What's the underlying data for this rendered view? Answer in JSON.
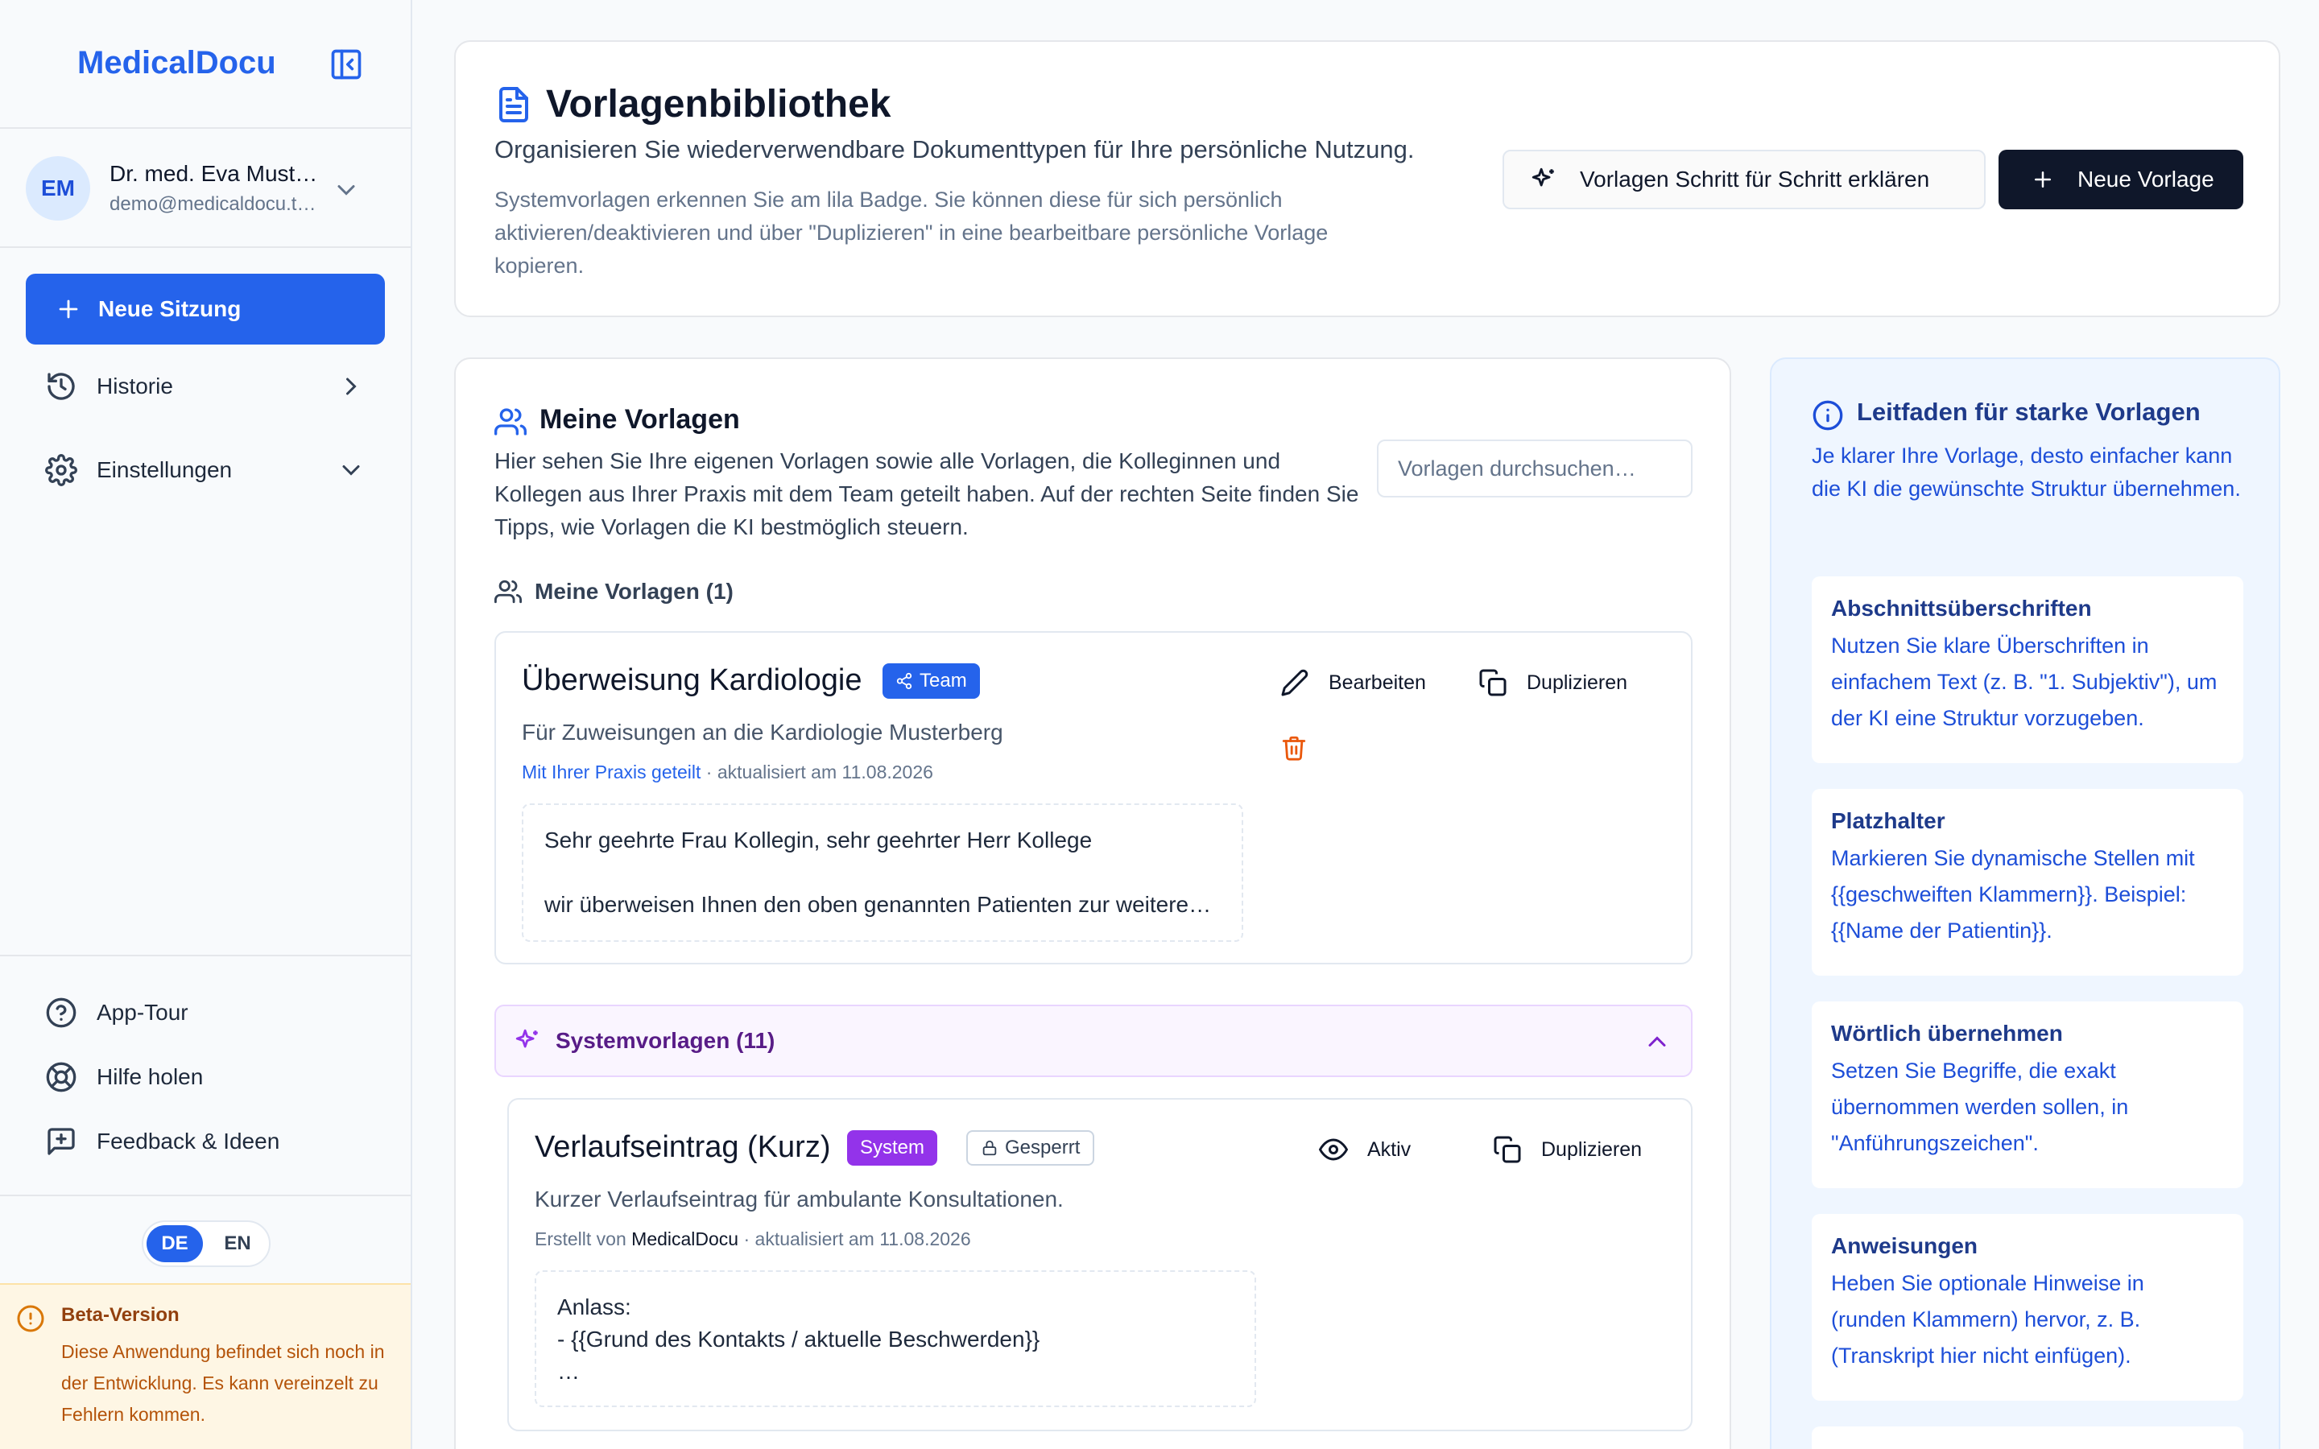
{
  "sidebar": {
    "brand": "MedicalDocu",
    "user": {
      "initials": "EM",
      "name": "Dr. med. Eva Must…",
      "email": "demo@medicaldocu.t…"
    },
    "new_session": "Neue Sitzung",
    "nav": [
      {
        "label": "Historie",
        "icon": "history-icon"
      },
      {
        "label": "Einstellungen",
        "icon": "gear-icon"
      }
    ],
    "bottom": [
      {
        "label": "App-Tour",
        "icon": "help-circle-icon"
      },
      {
        "label": "Hilfe holen",
        "icon": "lifebuoy-icon"
      },
      {
        "label": "Feedback & Ideen",
        "icon": "feedback-icon"
      }
    ],
    "lang": {
      "de": "DE",
      "en": "EN",
      "active": "DE"
    },
    "beta": {
      "title": "Beta-Version",
      "text": "Diese Anwendung befindet sich noch in der Entwicklung. Es kann vereinzelt zu Fehlern kommen."
    }
  },
  "header": {
    "title": "Vorlagenbibliothek",
    "subtitle": "Organisieren Sie wiederverwendbare Dokumenttypen für Ihre persönliche Nutzung.",
    "description": "Systemvorlagen erkennen Sie am lila Badge. Sie können diese für sich persönlich aktivieren/deaktivieren und über \"Duplizieren\" in eine bearbeitbare persönliche Vorlage kopieren.",
    "explain_button": "Vorlagen Schritt für Schritt erklären",
    "new_button": "Neue Vorlage"
  },
  "my_templates": {
    "title": "Meine Vorlagen",
    "description": "Hier sehen Sie Ihre eigenen Vorlagen sowie alle Vorlagen, die Kolleginnen und Kollegen aus Ihrer Praxis mit dem Team geteilt haben. Auf der rechten Seite finden Sie Tipps, wie Vorlagen die KI bestmöglich steuern.",
    "search_placeholder": "Vorlagen durchsuchen…",
    "group_label": "Meine Vorlagen (1)",
    "items": [
      {
        "title": "Überweisung Kardiologie",
        "badge": "Team",
        "description": "Für Zuweisungen an die Kardiologie Musterberg",
        "shared": "Mit Ihrer Praxis geteilt",
        "updated": "· aktualisiert am 11.08.2026",
        "preview_line1": "Sehr geehrte Frau Kollegin, sehr geehrter Herr Kollege",
        "preview_line2": "wir überweisen Ihnen den oben genannten Patienten zur weitere…",
        "edit": "Bearbeiten",
        "duplicate": "Duplizieren"
      }
    ]
  },
  "system_templates": {
    "label": "Systemvorlagen (11)",
    "items": [
      {
        "title": "Verlaufseintrag (Kurz)",
        "badge_system": "System",
        "badge_locked": "Gesperrt",
        "description": "Kurzer Verlaufseintrag für ambulante Konsultationen.",
        "created_prefix": "Erstellt von",
        "created_by": "MedicalDocu",
        "updated": "· aktualisiert am 11.08.2026",
        "preview_line1": "Anlass:",
        "preview_line2": "- {{Grund des Kontakts / aktuelle Beschwerden}}",
        "preview_line3": "…",
        "active": "Aktiv",
        "duplicate": "Duplizieren"
      }
    ]
  },
  "guide": {
    "title": "Leitfaden für starke Vorlagen",
    "intro": "Je klarer Ihre Vorlage, desto einfacher kann die KI die gewünschte Struktur übernehmen.",
    "tips": [
      {
        "title": "Abschnittsüberschriften",
        "text": "Nutzen Sie klare Überschriften in einfachem Text (z. B. \"1. Subjektiv\"), um der KI eine Struktur vorzugeben."
      },
      {
        "title": "Platzhalter",
        "text": "Markieren Sie dynamische Stellen mit {{geschweiften Klammern}}. Beispiel: {{Name der Patientin}}."
      },
      {
        "title": "Wörtlich übernehmen",
        "text": "Setzen Sie Begriffe, die exakt übernommen werden sollen, in \"Anführungszeichen\"."
      },
      {
        "title": "Anweisungen",
        "text": "Heben Sie optionale Hinweise in (runden Klammern) hervor, z. B. (Transkript hier nicht einfügen)."
      }
    ]
  },
  "colors": {
    "primary": "#2563eb",
    "system": "#9333ea",
    "dark": "#0f172a",
    "beta_bg": "#fef6e4"
  }
}
